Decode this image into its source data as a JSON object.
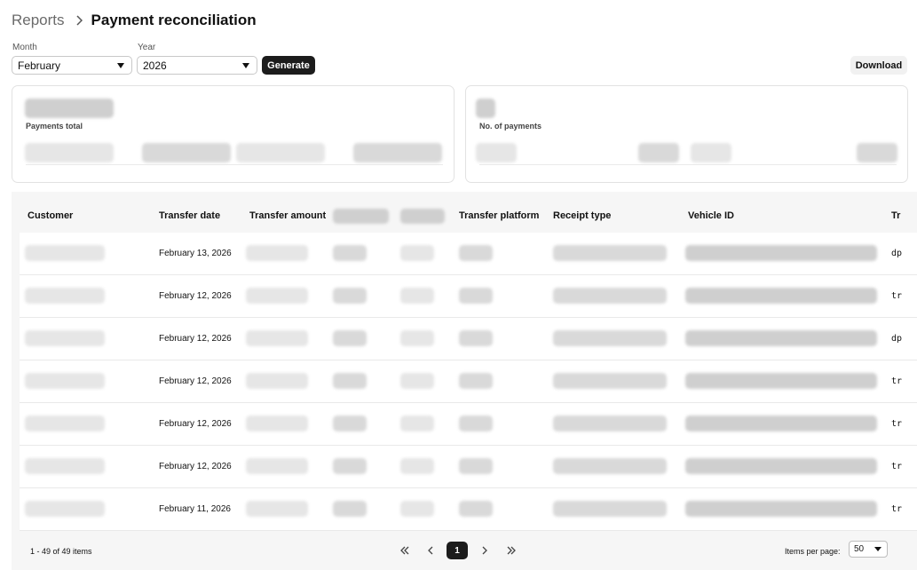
{
  "breadcrumb": {
    "root": "Reports",
    "current": "Payment reconciliation"
  },
  "filters": {
    "month_label": "Month",
    "month_value": "February",
    "year_label": "Year",
    "year_value": "2026",
    "generate_label": "Generate",
    "download_label": "Download"
  },
  "cards": {
    "payments_total_label": "Payments total",
    "payments_count_label": "No. of payments"
  },
  "table": {
    "columns": [
      "Customer",
      "Transfer date",
      "Transfer amount",
      "Transfer platform",
      "Receipt type",
      "Vehicle ID",
      "Tr"
    ],
    "rows": [
      {
        "date": "February 13, 2026",
        "trunc": "dp"
      },
      {
        "date": "February 12, 2026",
        "trunc": "tr"
      },
      {
        "date": "February 12, 2026",
        "trunc": "dp"
      },
      {
        "date": "February 12, 2026",
        "trunc": "tr"
      },
      {
        "date": "February 12, 2026",
        "trunc": "tr"
      },
      {
        "date": "February 12, 2026",
        "trunc": "tr"
      },
      {
        "date": "February 11, 2026",
        "trunc": "tr"
      }
    ]
  },
  "pagination": {
    "summary": "1 - 49 of 49 items",
    "current_page": "1",
    "items_per_page_label": "Items per page:",
    "items_per_page_value": "50"
  },
  "colors": {
    "primary_dark": "#1c1c1c",
    "table_bg": "#f6f6f6",
    "redacted": "#d9d9d9"
  }
}
